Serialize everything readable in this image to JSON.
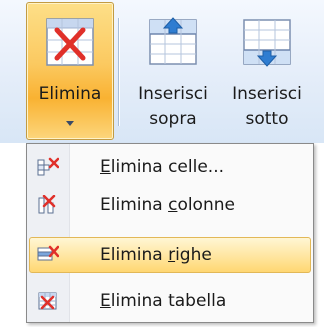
{
  "ribbon": {
    "elimina": {
      "label": "Elimina",
      "icon": "delete-table-icon",
      "state": "active"
    },
    "inserisci_sopra": {
      "line1": "Inserisci",
      "line2": "sopra",
      "icon": "insert-row-above-icon"
    },
    "inserisci_sotto": {
      "line1": "Inserisci",
      "line2": "sotto",
      "icon": "insert-row-below-icon"
    }
  },
  "menu": {
    "items": [
      {
        "pre": "",
        "key": "E",
        "post": "limina celle...",
        "icon": "delete-cells-icon"
      },
      {
        "pre": "Elimina ",
        "key": "c",
        "post": "olonne",
        "icon": "delete-columns-icon"
      },
      {
        "pre": "Elimina ",
        "key": "r",
        "post": "ighe",
        "icon": "delete-rows-icon",
        "highlighted": true
      },
      {
        "pre": "",
        "key": "E",
        "post": "limina tabella",
        "icon": "delete-table-icon"
      }
    ]
  },
  "colors": {
    "ribbon_bg": "#dfe9f5",
    "active_button": "#fbc960",
    "menu_highlight": "#ffe7a4",
    "delete_red": "#e0302a",
    "insert_blue": "#2f7dd1"
  }
}
